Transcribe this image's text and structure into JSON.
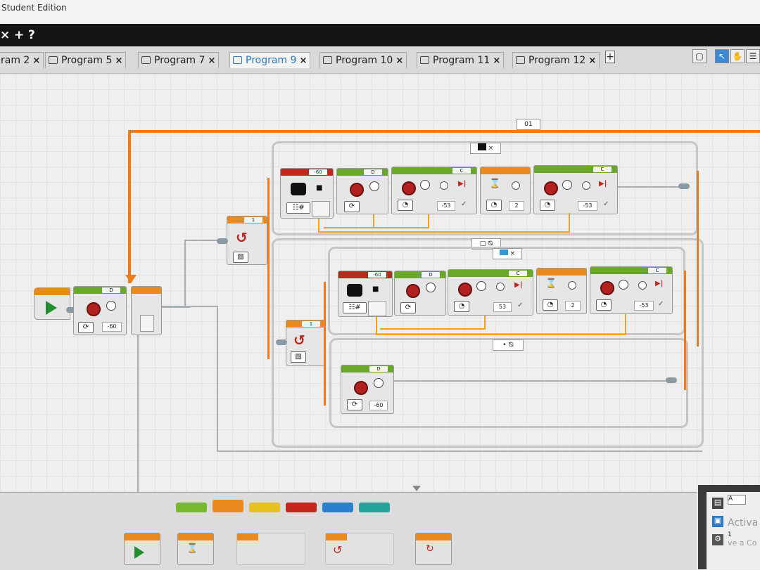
{
  "window": {
    "title": "Student Edition"
  },
  "menubar": {
    "close": "×",
    "plus": "+",
    "help": "?"
  },
  "tabs": [
    {
      "label": "ram 2",
      "active": false
    },
    {
      "label": "Program 5",
      "active": false
    },
    {
      "label": "Program 7",
      "active": false
    },
    {
      "label": "Program 9",
      "active": true
    },
    {
      "label": "Program 10",
      "active": false
    },
    {
      "label": "Program 11",
      "active": false
    },
    {
      "label": "Program 12",
      "active": false
    }
  ],
  "tab_close_glyph": "×",
  "add_tab_glyph": "+",
  "program": {
    "loop_label": "01",
    "start_block": {
      "port": "D",
      "value": "-60"
    },
    "switch_outer": {
      "value": "1"
    },
    "switch_inner": {
      "value": "1"
    },
    "top_row": {
      "math_block": {
        "value": "-60"
      },
      "motor_d": {
        "port": "D"
      },
      "motor_c1": {
        "port": "C",
        "value": "-53"
      },
      "wait": {
        "value": "2"
      },
      "motor_c2": {
        "port": "C",
        "value": "-53"
      }
    },
    "mid_row": {
      "math_block": {
        "value": "-60"
      },
      "motor_d": {
        "port": "D"
      },
      "motor_c1": {
        "port": "C",
        "value": "53"
      },
      "wait": {
        "value": "2"
      },
      "motor_c2": {
        "port": "C",
        "value": "-53"
      }
    },
    "bottom_row": {
      "motor_d": {
        "port": "D",
        "value": "-60"
      }
    }
  },
  "palette_colors": [
    "#78b82c",
    "#ea8a1c",
    "#e6c21c",
    "#c4261e",
    "#2a7fd1",
    "#25a59a"
  ],
  "rightpanel": {
    "label_a": "A",
    "label_1": "1",
    "watermark": "Activa",
    "watermark2": "ve a Co"
  }
}
